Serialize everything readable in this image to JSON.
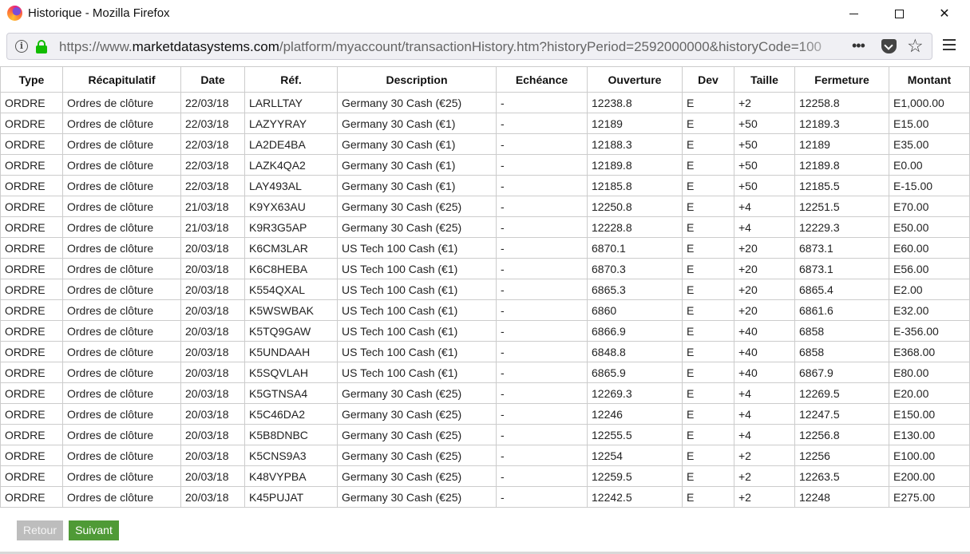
{
  "window": {
    "title": "Historique - Mozilla Firefox",
    "min_glyph": "",
    "close_glyph": "✕"
  },
  "toolbar": {
    "url_prefix": "https://www.",
    "url_host": "marketdatasystems.com",
    "url_path": "/platform/myaccount/transactionHistory.htm?historyPeriod=2592000000&historyCode=100",
    "more_glyph": "•••",
    "bookmark_glyph": "☆"
  },
  "table": {
    "columns": [
      "Type",
      "Récapitulatif",
      "Date",
      "Réf.",
      "Description",
      "Echéance",
      "Ouverture",
      "Dev",
      "Taille",
      "Fermeture",
      "Montant"
    ],
    "rows": [
      [
        "ORDRE",
        "Ordres de clôture",
        "22/03/18",
        "LARLLTAY",
        "Germany 30 Cash (€25)",
        "-",
        "12238.8",
        "E",
        "+2",
        "12258.8",
        "E1,000.00"
      ],
      [
        "ORDRE",
        "Ordres de clôture",
        "22/03/18",
        "LAZYYRAY",
        "Germany 30 Cash (€1)",
        "-",
        "12189",
        "E",
        "+50",
        "12189.3",
        "E15.00"
      ],
      [
        "ORDRE",
        "Ordres de clôture",
        "22/03/18",
        "LA2DE4BA",
        "Germany 30 Cash (€1)",
        "-",
        "12188.3",
        "E",
        "+50",
        "12189",
        "E35.00"
      ],
      [
        "ORDRE",
        "Ordres de clôture",
        "22/03/18",
        "LAZK4QA2",
        "Germany 30 Cash (€1)",
        "-",
        "12189.8",
        "E",
        "+50",
        "12189.8",
        "E0.00"
      ],
      [
        "ORDRE",
        "Ordres de clôture",
        "22/03/18",
        "LAY493AL",
        "Germany 30 Cash (€1)",
        "-",
        "12185.8",
        "E",
        "+50",
        "12185.5",
        "E-15.00"
      ],
      [
        "ORDRE",
        "Ordres de clôture",
        "21/03/18",
        "K9YX63AU",
        "Germany 30 Cash (€25)",
        "-",
        "12250.8",
        "E",
        "+4",
        "12251.5",
        "E70.00"
      ],
      [
        "ORDRE",
        "Ordres de clôture",
        "21/03/18",
        "K9R3G5AP",
        "Germany 30 Cash (€25)",
        "-",
        "12228.8",
        "E",
        "+4",
        "12229.3",
        "E50.00"
      ],
      [
        "ORDRE",
        "Ordres de clôture",
        "20/03/18",
        "K6CM3LAR",
        "US Tech 100 Cash (€1)",
        "-",
        "6870.1",
        "E",
        "+20",
        "6873.1",
        "E60.00"
      ],
      [
        "ORDRE",
        "Ordres de clôture",
        "20/03/18",
        "K6C8HEBA",
        "US Tech 100 Cash (€1)",
        "-",
        "6870.3",
        "E",
        "+20",
        "6873.1",
        "E56.00"
      ],
      [
        "ORDRE",
        "Ordres de clôture",
        "20/03/18",
        "K554QXAL",
        "US Tech 100 Cash (€1)",
        "-",
        "6865.3",
        "E",
        "+20",
        "6865.4",
        "E2.00"
      ],
      [
        "ORDRE",
        "Ordres de clôture",
        "20/03/18",
        "K5WSWBAK",
        "US Tech 100 Cash (€1)",
        "-",
        "6860",
        "E",
        "+20",
        "6861.6",
        "E32.00"
      ],
      [
        "ORDRE",
        "Ordres de clôture",
        "20/03/18",
        "K5TQ9GAW",
        "US Tech 100 Cash (€1)",
        "-",
        "6866.9",
        "E",
        "+40",
        "6858",
        "E-356.00"
      ],
      [
        "ORDRE",
        "Ordres de clôture",
        "20/03/18",
        "K5UNDAAH",
        "US Tech 100 Cash (€1)",
        "-",
        "6848.8",
        "E",
        "+40",
        "6858",
        "E368.00"
      ],
      [
        "ORDRE",
        "Ordres de clôture",
        "20/03/18",
        "K5SQVLAH",
        "US Tech 100 Cash (€1)",
        "-",
        "6865.9",
        "E",
        "+40",
        "6867.9",
        "E80.00"
      ],
      [
        "ORDRE",
        "Ordres de clôture",
        "20/03/18",
        "K5GTNSA4",
        "Germany 30 Cash (€25)",
        "-",
        "12269.3",
        "E",
        "+4",
        "12269.5",
        "E20.00"
      ],
      [
        "ORDRE",
        "Ordres de clôture",
        "20/03/18",
        "K5C46DA2",
        "Germany 30 Cash (€25)",
        "-",
        "12246",
        "E",
        "+4",
        "12247.5",
        "E150.00"
      ],
      [
        "ORDRE",
        "Ordres de clôture",
        "20/03/18",
        "K5B8DNBC",
        "Germany 30 Cash (€25)",
        "-",
        "12255.5",
        "E",
        "+4",
        "12256.8",
        "E130.00"
      ],
      [
        "ORDRE",
        "Ordres de clôture",
        "20/03/18",
        "K5CNS9A3",
        "Germany 30 Cash (€25)",
        "-",
        "12254",
        "E",
        "+2",
        "12256",
        "E100.00"
      ],
      [
        "ORDRE",
        "Ordres de clôture",
        "20/03/18",
        "K48VYPBA",
        "Germany 30 Cash (€25)",
        "-",
        "12259.5",
        "E",
        "+2",
        "12263.5",
        "E200.00"
      ],
      [
        "ORDRE",
        "Ordres de clôture",
        "20/03/18",
        "K45PUJAT",
        "Germany 30 Cash (€25)",
        "-",
        "12242.5",
        "E",
        "+2",
        "12248",
        "E275.00"
      ]
    ]
  },
  "pagination": {
    "back_label": "Retour",
    "next_label": "Suivant"
  },
  "colors": {
    "next_button": "#4f9a36",
    "back_button": "#bdbdbd",
    "lock_green": "#12bc00"
  }
}
